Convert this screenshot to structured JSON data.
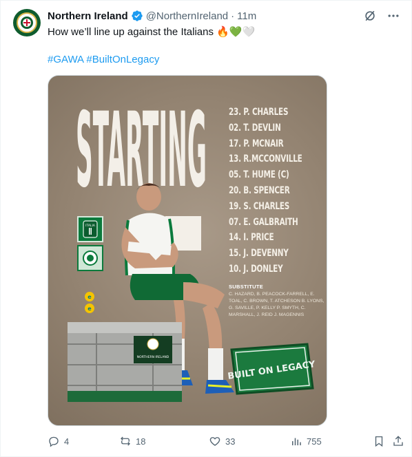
{
  "tweet": {
    "author_name": "Northern Ireland",
    "handle": "@NorthernIreland",
    "separator": "·",
    "time": "11m",
    "text": "How we’ll line up against the Italians 🔥💚🤍",
    "hashtags": [
      "#GAWA",
      "#BuiltOnLegacy"
    ],
    "verified": true
  },
  "graphic": {
    "heading": "STARTING",
    "lineup": [
      "23. P. CHARLES",
      "02. T. DEVLIN",
      "17. P. MCNAIR",
      "13. R.MCCONVILLE",
      "05. T. HUME (C)",
      "20. B. SPENCER",
      "19. S. CHARLES",
      "07. E. GALBRAITH",
      "14. I. PRICE",
      "15. J. DEVENNY",
      "10. J. DONLEY"
    ],
    "substitute_title": "SUBSTITUTE",
    "substitutes": "C. HAZARD, B. PEACOCK-FARRELL, E. TOAL, C. BROWN, T. ATCHESON B. LYONS, G. SAVILLE, P. KELLY P. SMYTH, C. MARSHALL, J. REID J. MAGENNIS",
    "italia_badge": "ITALIA",
    "campaign_badge": "BUILT ON LEGACY",
    "sponsor": "EE",
    "trunk_label": "NORTHERN IRELAND"
  },
  "stats": {
    "replies": "4",
    "reposts": "18",
    "likes": "33",
    "views": "755"
  },
  "colors": {
    "link": "#1d9bf0",
    "muted": "#536471",
    "verified": "#1d9bf0",
    "green": "#0b7a3c",
    "poster_bg": "#938371"
  },
  "icons": [
    "grok-icon",
    "more-icon",
    "reply-icon",
    "repost-icon",
    "like-icon",
    "views-icon",
    "bookmark-icon",
    "share-icon"
  ]
}
